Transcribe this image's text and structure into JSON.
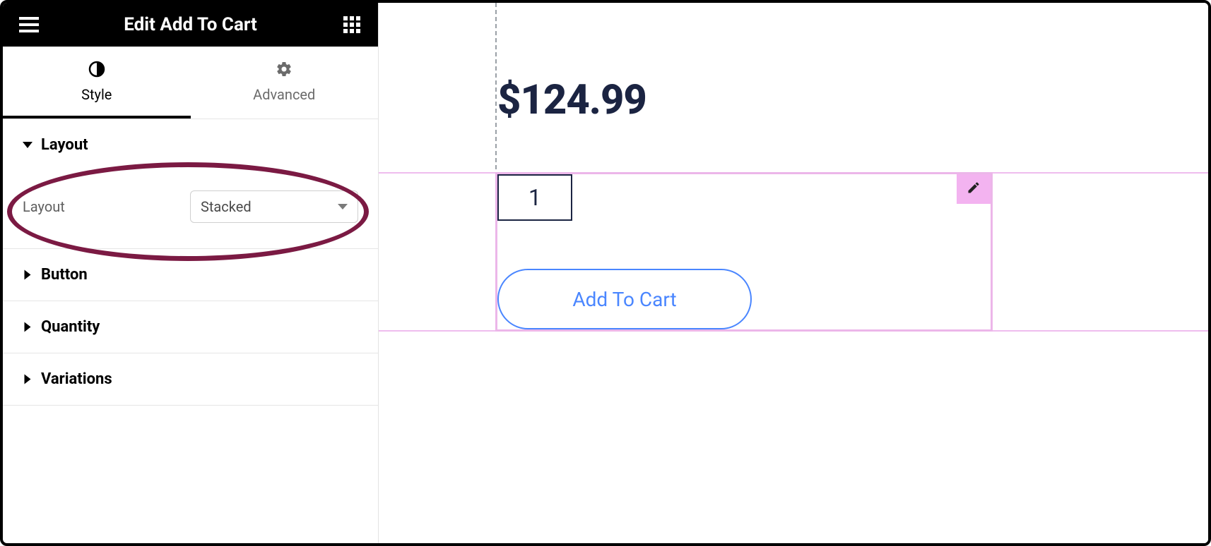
{
  "header": {
    "title": "Edit Add To Cart"
  },
  "tabs": {
    "style": "Style",
    "advanced": "Advanced",
    "active": "style"
  },
  "sections": {
    "layout": {
      "title": "Layout",
      "field_label": "Layout",
      "field_value": "Stacked",
      "expanded": true
    },
    "button": {
      "title": "Button",
      "expanded": false
    },
    "quantity": {
      "title": "Quantity",
      "expanded": false
    },
    "variations": {
      "title": "Variations",
      "expanded": false
    }
  },
  "preview": {
    "price": "$124.99",
    "quantity_value": "1",
    "button_label": "Add To Cart"
  },
  "colors": {
    "annotation": "#7b1a43",
    "selection": "#ecb6e9",
    "accent_blue": "#4a86ff",
    "dark_navy": "#1b2442"
  }
}
